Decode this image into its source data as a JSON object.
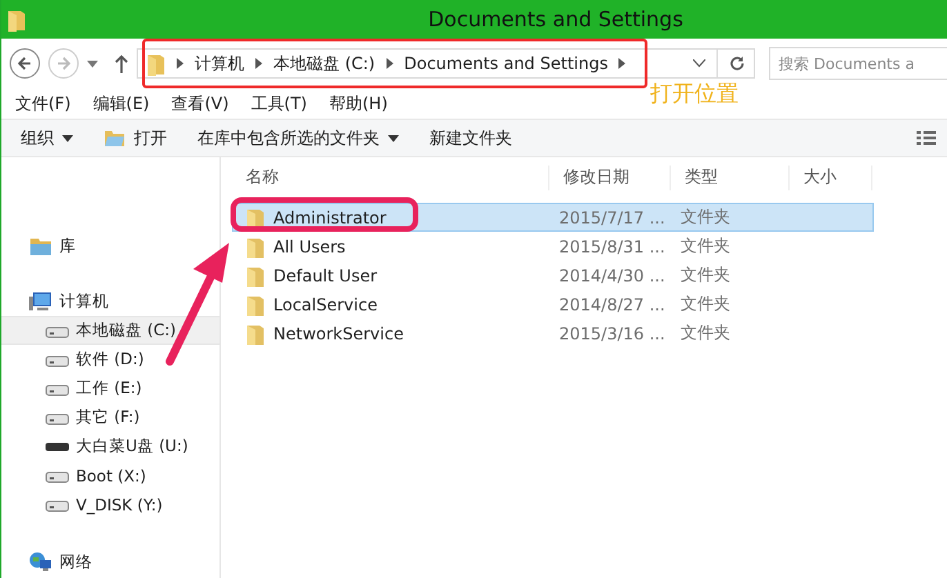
{
  "window": {
    "title": "Documents and Settings"
  },
  "navigation": {
    "breadcrumb": [
      "计算机",
      "本地磁盘 (C:)",
      "Documents and Settings"
    ],
    "search": {
      "placeholder": "搜索 Documents a"
    }
  },
  "menu_bar": [
    "文件(F)",
    "编辑(E)",
    "查看(V)",
    "工具(T)",
    "帮助(H)"
  ],
  "toolbar": [
    {
      "label": "组织",
      "kind": "dropdown"
    },
    {
      "label": "打开",
      "kind": "icon"
    },
    {
      "label": "在库中包含所选的文件夹",
      "kind": "dropdown"
    },
    {
      "label": "新建文件夹",
      "kind": "plain"
    }
  ],
  "sidebar": {
    "items": [
      {
        "label": "库",
        "kind": "library",
        "selected": false
      },
      {
        "label": "计算机",
        "kind": "computer",
        "selected": false,
        "children": [
          {
            "label": "本地磁盘 (C:)",
            "kind": "drive",
            "selected": true
          },
          {
            "label": "软件 (D:)",
            "kind": "drive",
            "selected": false
          },
          {
            "label": "工作 (E:)",
            "kind": "drive",
            "selected": false
          },
          {
            "label": "其它 (F:)",
            "kind": "drive",
            "selected": false
          },
          {
            "label": "大白菜U盘 (U:)",
            "kind": "usb",
            "selected": false
          },
          {
            "label": "Boot (X:)",
            "kind": "drive",
            "selected": false
          },
          {
            "label": "V_DISK (Y:)",
            "kind": "drive",
            "selected": false
          }
        ]
      },
      {
        "label": "网络",
        "kind": "network",
        "selected": false
      }
    ]
  },
  "file_list": {
    "columns": [
      "名称",
      "修改日期",
      "类型",
      "大小"
    ],
    "rows": [
      {
        "name": "Administrator",
        "modified": "2015/7/17 ...",
        "type": "文件夹",
        "selected": true
      },
      {
        "name": "All Users",
        "modified": "2015/8/31 ...",
        "type": "文件夹",
        "selected": false
      },
      {
        "name": "Default User",
        "modified": "2014/4/30 ...",
        "type": "文件夹",
        "selected": false
      },
      {
        "name": "LocalService",
        "modified": "2014/8/27 ...",
        "type": "文件夹",
        "selected": false
      },
      {
        "name": "NetworkService",
        "modified": "2015/3/16 ...",
        "type": "文件夹",
        "selected": false
      }
    ]
  },
  "annotations": {
    "callout": "打开位置"
  }
}
